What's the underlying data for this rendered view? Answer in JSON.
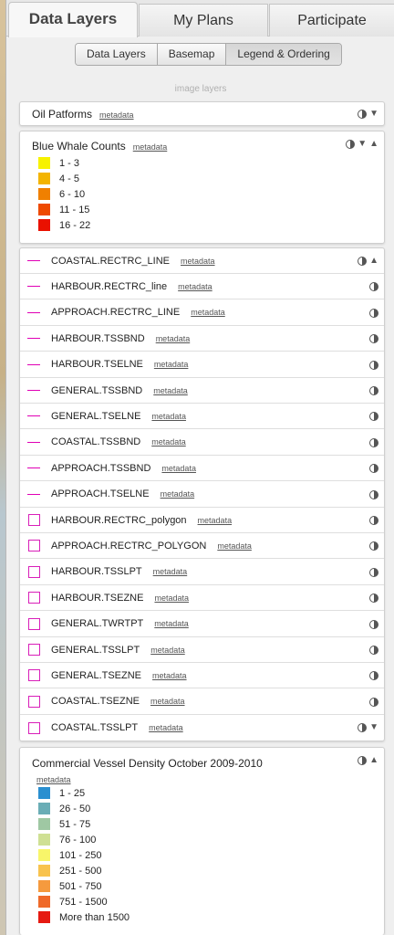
{
  "tabs": [
    {
      "label": "Data Layers",
      "active": true
    },
    {
      "label": "My Plans",
      "active": false
    },
    {
      "label": "Participate",
      "active": false
    }
  ],
  "subtabs": [
    {
      "label": "Data Layers",
      "active": false
    },
    {
      "label": "Basemap",
      "active": false
    },
    {
      "label": "Legend & Ordering",
      "active": true
    }
  ],
  "section_label": "image layers",
  "oil": {
    "title": "Oil Patforms",
    "metadata": "metadata"
  },
  "whale": {
    "title": "Blue Whale Counts",
    "metadata": "metadata",
    "legend": [
      {
        "label": "1 - 3",
        "color": "#f7f200"
      },
      {
        "label": "4 - 5",
        "color": "#f3b400"
      },
      {
        "label": "6 - 10",
        "color": "#f08000"
      },
      {
        "label": "11 - 15",
        "color": "#ee4a00"
      },
      {
        "label": "16 - 22",
        "color": "#ea1100"
      }
    ]
  },
  "layers": [
    {
      "name": "COASTAL.RECTRC_LINE",
      "metadata": "metadata",
      "symbol": "line"
    },
    {
      "name": "HARBOUR.RECTRC_line",
      "metadata": "metadata",
      "symbol": "line"
    },
    {
      "name": "APPROACH.RECTRC_LINE",
      "metadata": "metadata",
      "symbol": "line"
    },
    {
      "name": "HARBOUR.TSSBND",
      "metadata": "metadata",
      "symbol": "line"
    },
    {
      "name": "HARBOUR.TSELNE",
      "metadata": "metadata",
      "symbol": "line"
    },
    {
      "name": "GENERAL.TSSBND",
      "metadata": "metadata",
      "symbol": "line"
    },
    {
      "name": "GENERAL.TSELNE",
      "metadata": "metadata",
      "symbol": "line"
    },
    {
      "name": "COASTAL.TSSBND",
      "metadata": "metadata",
      "symbol": "line"
    },
    {
      "name": "APPROACH.TSSBND",
      "metadata": "metadata",
      "symbol": "line"
    },
    {
      "name": "APPROACH.TSELNE",
      "metadata": "metadata",
      "symbol": "line"
    },
    {
      "name": "HARBOUR.RECTRC_polygon",
      "metadata": "metadata",
      "symbol": "polygon"
    },
    {
      "name": "APPROACH.RECTRC_POLYGON",
      "metadata": "metadata",
      "symbol": "polygon"
    },
    {
      "name": "HARBOUR.TSSLPT",
      "metadata": "metadata",
      "symbol": "polygon"
    },
    {
      "name": "HARBOUR.TSEZNE",
      "metadata": "metadata",
      "symbol": "polygon"
    },
    {
      "name": "GENERAL.TWRTPT",
      "metadata": "metadata",
      "symbol": "polygon"
    },
    {
      "name": "GENERAL.TSSLPT",
      "metadata": "metadata",
      "symbol": "polygon"
    },
    {
      "name": "GENERAL.TSEZNE",
      "metadata": "metadata",
      "symbol": "polygon"
    },
    {
      "name": "COASTAL.TSEZNE",
      "metadata": "metadata",
      "symbol": "polygon"
    },
    {
      "name": "COASTAL.TSSLPT",
      "metadata": "metadata",
      "symbol": "polygon"
    }
  ],
  "vessel": {
    "title": "Commercial Vessel Density October 2009-2010",
    "metadata": "metadata",
    "legend": [
      {
        "label": "1 - 25",
        "color": "#2a8fd0"
      },
      {
        "label": "26 - 50",
        "color": "#6aadb6"
      },
      {
        "label": "51 - 75",
        "color": "#9fc8a3"
      },
      {
        "label": "76 - 100",
        "color": "#cfe094"
      },
      {
        "label": "101 - 250",
        "color": "#f8f56a"
      },
      {
        "label": "251 - 500",
        "color": "#f8c34e"
      },
      {
        "label": "501 - 750",
        "color": "#f59a3e"
      },
      {
        "label": "751 - 1500",
        "color": "#ef6a2a"
      },
      {
        "label": "More than 1500",
        "color": "#e61a12"
      }
    ]
  },
  "icons": {
    "opacity": "half-circle-opacity-icon",
    "up": "arrow-up-icon",
    "down": "arrow-down-icon"
  }
}
